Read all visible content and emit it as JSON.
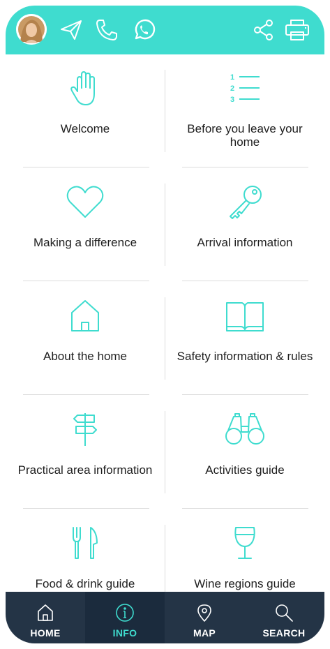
{
  "colors": {
    "accent": "#3fdccf",
    "nav_bg": "#243446",
    "nav_active_bg": "#1b2b3d",
    "text": "#1e1e1e",
    "divider": "#dcdcdc"
  },
  "topbar": {
    "left_icons": [
      "avatar",
      "paper-plane-icon",
      "phone-icon",
      "whatsapp-icon"
    ],
    "right_icons": [
      "share-icon",
      "printer-icon"
    ]
  },
  "grid": {
    "items": [
      {
        "label": "Welcome",
        "icon": "hand-icon"
      },
      {
        "label": "Before you leave your home",
        "icon": "numbered-list-icon",
        "list_numbers": [
          "1",
          "2",
          "3"
        ]
      },
      {
        "label": "Making a difference",
        "icon": "heart-icon"
      },
      {
        "label": "Arrival information",
        "icon": "key-icon"
      },
      {
        "label": "About the home",
        "icon": "house-icon"
      },
      {
        "label": "Safety information & rules",
        "icon": "book-icon"
      },
      {
        "label": "Practical area information",
        "icon": "signpost-icon"
      },
      {
        "label": "Activities guide",
        "icon": "binoculars-icon"
      },
      {
        "label": "Food & drink guide",
        "icon": "cutlery-icon"
      },
      {
        "label": "Wine regions guide",
        "icon": "wine-glass-icon"
      }
    ]
  },
  "bottom_nav": {
    "items": [
      {
        "label": "HOME",
        "icon": "home-icon",
        "active": false
      },
      {
        "label": "INFO",
        "icon": "info-icon",
        "active": true
      },
      {
        "label": "MAP",
        "icon": "map-pin-icon",
        "active": false
      },
      {
        "label": "SEARCH",
        "icon": "search-icon",
        "active": false
      }
    ]
  }
}
